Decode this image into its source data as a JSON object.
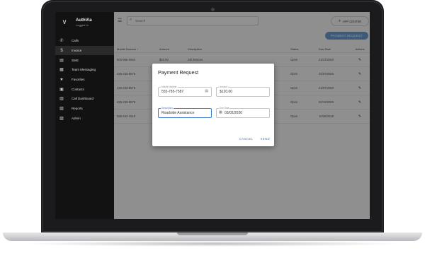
{
  "brand": {
    "name": "AuthVia",
    "status": "Logged In",
    "logo_icon": "chevron-logo-icon"
  },
  "sidebar": {
    "items": [
      {
        "label": "Calls",
        "icon": "phone-icon",
        "glyph": "✆",
        "active": false
      },
      {
        "label": "Invoice",
        "icon": "dollar-icon",
        "glyph": "$",
        "active": true
      },
      {
        "label": "SMS",
        "icon": "chat-icon",
        "glyph": "▤",
        "active": false
      },
      {
        "label": "Team Messaging",
        "icon": "team-chat-icon",
        "glyph": "▦",
        "active": false
      },
      {
        "label": "Favorites",
        "icon": "star-icon",
        "glyph": "★",
        "active": false
      },
      {
        "label": "Contacts",
        "icon": "contacts-icon",
        "glyph": "▣",
        "active": false
      },
      {
        "label": "Call Dashboard",
        "icon": "dashboard-icon",
        "glyph": "▥",
        "active": false
      },
      {
        "label": "Reports",
        "icon": "reports-icon",
        "glyph": "▧",
        "active": false
      },
      {
        "label": "Admin",
        "icon": "admin-icon",
        "glyph": "▨",
        "active": false
      }
    ]
  },
  "topbar": {
    "search_placeholder": "Search",
    "app_center_label": "APP CENTER"
  },
  "main": {
    "payment_request_button": "PAYMENT REQUEST"
  },
  "table": {
    "headers": [
      "Mobile Number ↑",
      "Amount",
      "Description",
      "Status",
      "Due Date",
      "Actions"
    ],
    "rows": [
      {
        "mobile": "503-955-0943",
        "amount": "$10.00",
        "description": "Ski lessons",
        "status": "Open",
        "due": "01/27/2020"
      },
      {
        "mobile": "425-233-5575",
        "amount": "",
        "description": "",
        "status": "Open",
        "due": "01/07/2020"
      },
      {
        "mobile": "425-233-5575",
        "amount": "",
        "description": "",
        "status": "Open",
        "due": "01/07/2020"
      },
      {
        "mobile": "425-233-5575",
        "amount": "",
        "description": "",
        "status": "Open",
        "due": "02/10/2020"
      },
      {
        "mobile": "555-442-1515",
        "amount": "",
        "description": "",
        "status": "Open",
        "due": "10/28/2019"
      }
    ]
  },
  "dialog": {
    "title": "Payment Request",
    "mobile_label": "Mobile Number",
    "mobile_value": "555-785-7587",
    "amount_label": "Amount",
    "amount_value": "$120.00",
    "description_label": "Description",
    "description_value": "Roadside Assistance",
    "due_label": "Due Date",
    "due_value": "03/02/2020",
    "cancel_label": "CANCEL",
    "send_label": "SEND"
  },
  "colors": {
    "accent": "#3f7fd0",
    "button_blue": "#6b9bd4",
    "sidebar_bg": "#121212"
  }
}
